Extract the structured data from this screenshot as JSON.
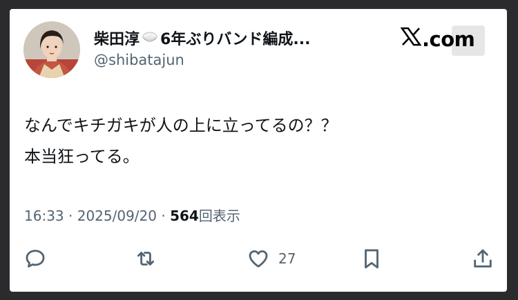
{
  "user": {
    "display_name_part1": "柴田淳",
    "display_name_part2": "6年ぶりバンド編成...",
    "handle": "@shibatajun",
    "avatar_icon": "profile-photo",
    "badge_icon": "rice-bowl-emoji"
  },
  "brand": {
    "logo_text": "com"
  },
  "tweet": {
    "lines": [
      "なんでキチガキが人の上に立ってるの？？",
      "本当狂ってる。"
    ]
  },
  "meta": {
    "time": "16:33",
    "separator": "·",
    "date": "2025/09/20",
    "views": "564",
    "views_label": "回表示"
  },
  "actions": {
    "reply_icon": "reply-icon",
    "retweet_icon": "retweet-icon",
    "like_icon": "heart-icon",
    "like_count": "27",
    "bookmark_icon": "bookmark-icon",
    "share_icon": "share-icon"
  },
  "colors": {
    "text_primary": "#0f1419",
    "text_secondary": "#536471",
    "background": "#ffffff",
    "frame": "#2b2b2d"
  }
}
